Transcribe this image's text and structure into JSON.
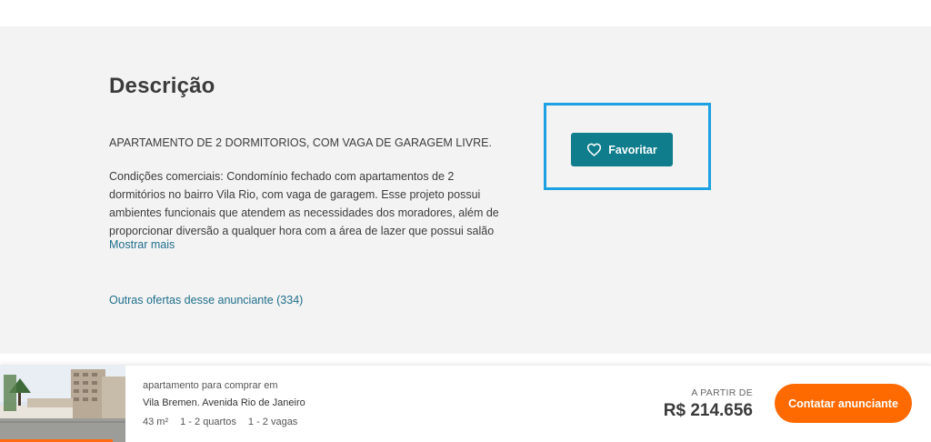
{
  "description": {
    "title": "Descrição",
    "headline": "APARTAMENTO DE 2 DORMITORIOS, COM VAGA DE GARAGEM LIVRE.",
    "body": "Condições comerciais: Condomínio fechado com apartamentos de 2 dormitórios no bairro Vila Rio, com vaga de garagem. Esse projeto possui ambientes funcionais que atendem as necessidades dos moradores, além de proporcionar diversão a qualquer hora com a área de lazer que possui salão de",
    "show_more": "Mostrar mais",
    "other_offers": "Outras ofertas desse anunciante (334)"
  },
  "favorite": {
    "label": "Favoritar",
    "icon": "heart-icon"
  },
  "listing": {
    "type_line": "apartamento para comprar em",
    "address": "Vila Bremen. Avenida Rio de Janeiro",
    "features": [
      "43 m²",
      "1 - 2 quartos",
      "1 - 2 vagas"
    ],
    "price_label": "A PARTIR DE",
    "price": "R$ 214.656",
    "contact_label": "Contatar anunciante"
  },
  "colors": {
    "favorite_button": "#0f7d8c",
    "highlight_border": "#1da1e2",
    "contact_button": "#ff6a00",
    "link": "#1f6f8b"
  }
}
